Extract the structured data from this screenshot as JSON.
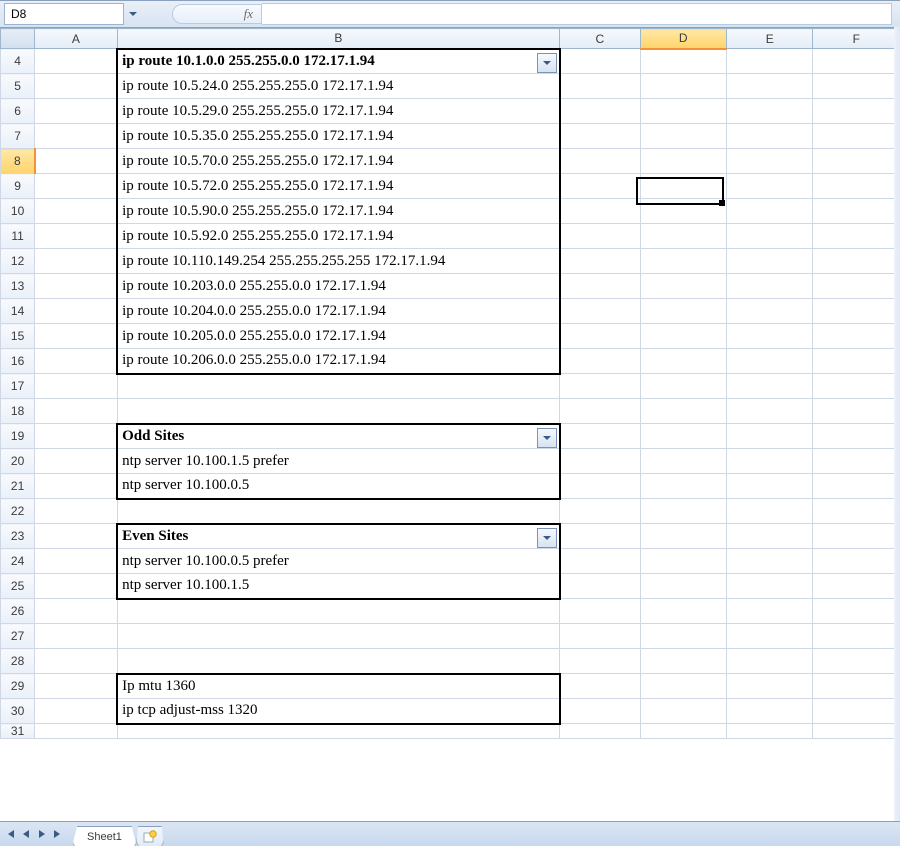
{
  "nameBox": "D8",
  "formulaBar": "",
  "fxLabel": "fx",
  "columns": [
    "A",
    "B",
    "C",
    "D",
    "E",
    "F"
  ],
  "activeCol": "D",
  "activeRowHeader": "8",
  "rowStart": 4,
  "rowEnd": 31,
  "sheetTab": "Sheet1",
  "block1": {
    "header": "ip route 10.1.0.0 255.255.0.0 172.17.1.94",
    "rows": [
      "ip route 10.5.24.0 255.255.255.0 172.17.1.94",
      "ip route 10.5.29.0 255.255.255.0 172.17.1.94",
      "ip route 10.5.35.0 255.255.255.0 172.17.1.94",
      "ip route 10.5.70.0 255.255.255.0 172.17.1.94",
      "ip route 10.5.72.0 255.255.255.0 172.17.1.94",
      "ip route 10.5.90.0 255.255.255.0 172.17.1.94",
      "ip route 10.5.92.0 255.255.255.0 172.17.1.94",
      "ip route 10.110.149.254 255.255.255.255 172.17.1.94",
      "ip route 10.203.0.0 255.255.0.0 172.17.1.94",
      "ip route 10.204.0.0 255.255.0.0 172.17.1.94",
      "ip route 10.205.0.0 255.255.0.0 172.17.1.94",
      "ip route 10.206.0.0 255.255.0.0 172.17.1.94"
    ]
  },
  "block2": {
    "header": "Odd Sites",
    "rows": [
      "ntp server 10.100.1.5 prefer",
      "ntp server 10.100.0.5"
    ]
  },
  "block3": {
    "header": "Even Sites",
    "rows": [
      "ntp server 10.100.0.5 prefer",
      "ntp server 10.100.1.5"
    ]
  },
  "block4": {
    "rows": [
      "Ip mtu 1360",
      "ip tcp adjust-mss 1320"
    ]
  }
}
